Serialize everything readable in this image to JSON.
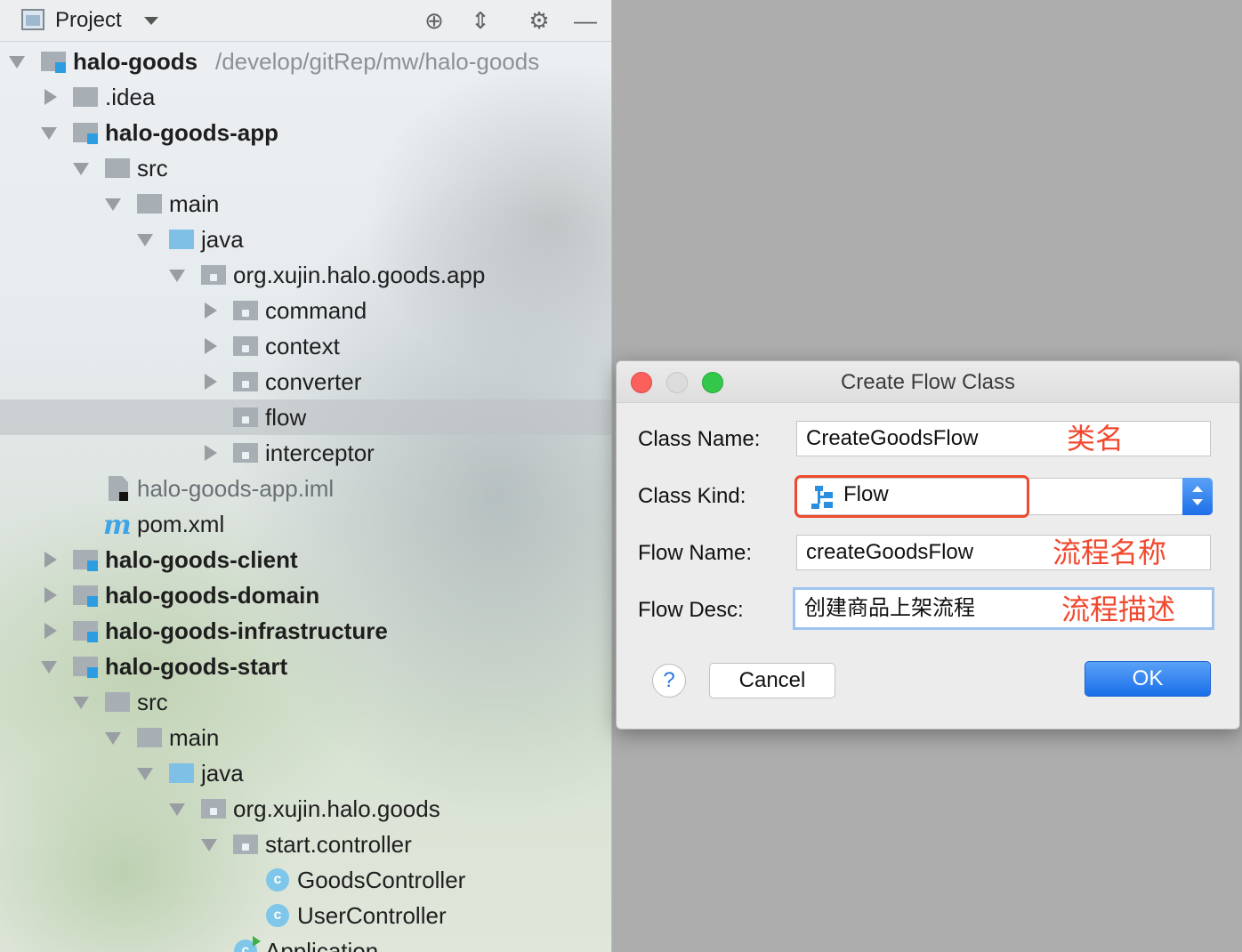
{
  "panel": {
    "title": "Project",
    "toolbar": {
      "locate_icon": "⊕",
      "collapse_icon": "⇕",
      "settings_icon": "⚙",
      "hide_icon": "—"
    },
    "root": {
      "name": "halo-goods",
      "path": "/develop/gitRep/mw/halo-goods"
    },
    "tree": {
      "idea": ".idea",
      "app_module": "halo-goods-app",
      "app_src": "src",
      "app_main": "main",
      "app_java": "java",
      "app_pkg": "org.xujin.halo.goods.app",
      "command": "command",
      "context": "context",
      "converter": "converter",
      "flow": "flow",
      "interceptor": "interceptor",
      "app_iml": "halo-goods-app.iml",
      "pom": "pom.xml",
      "client_module": "halo-goods-client",
      "domain_module": "halo-goods-domain",
      "infra_module": "halo-goods-infrastructure",
      "start_module": "halo-goods-start",
      "start_src": "src",
      "start_main": "main",
      "start_java": "java",
      "start_pkg": "org.xujin.halo.goods",
      "start_controller": "start.controller",
      "goods_controller": "GoodsController",
      "user_controller": "UserController",
      "application": "Application"
    }
  },
  "dialog": {
    "title": "Create Flow Class",
    "class_name_label": "Class Name:",
    "class_name_value": "CreateGoodsFlow",
    "class_kind_label": "Class Kind:",
    "class_kind_value": "Flow",
    "flow_name_label": "Flow Name:",
    "flow_name_value": "createGoodsFlow",
    "flow_desc_label": "Flow Desc:",
    "flow_desc_value": "创建商品上架流程",
    "help_label": "?",
    "cancel_label": "Cancel",
    "ok_label": "OK",
    "annotations": {
      "class_name": "类名",
      "flow_name": "流程名称",
      "flow_desc": "流程描述"
    }
  },
  "colors": {
    "accent": "#1e6fe8",
    "annotation": "#f1492f",
    "highlight": "#ee4a2e"
  }
}
